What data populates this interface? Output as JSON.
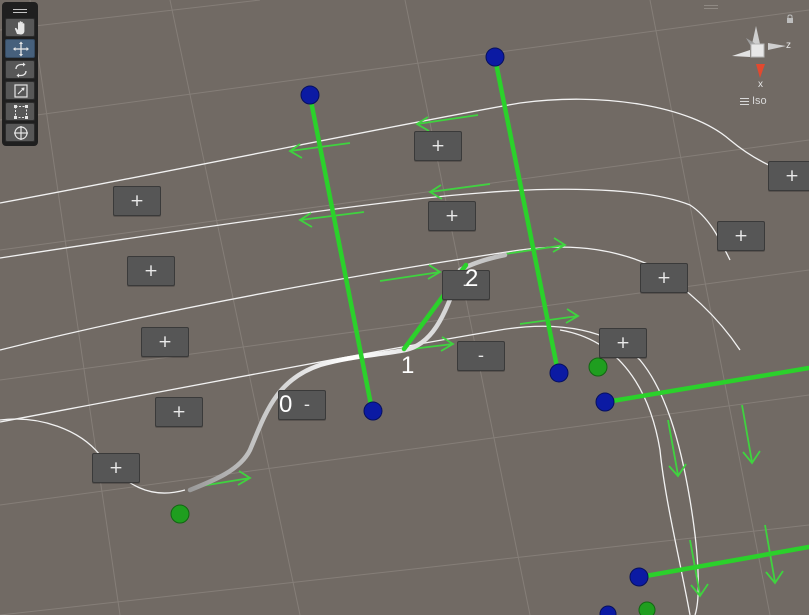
{
  "toolbar": {
    "tools": [
      {
        "name": "hand-tool",
        "icon": "hand-icon",
        "active": false
      },
      {
        "name": "move-tool",
        "icon": "move-icon",
        "active": true
      },
      {
        "name": "rotate-tool",
        "icon": "rotate-icon",
        "active": false
      },
      {
        "name": "scale-tool",
        "icon": "scale-icon",
        "active": false
      },
      {
        "name": "rect-tool",
        "icon": "rect-transform-icon",
        "active": false
      },
      {
        "name": "transform-tool",
        "icon": "transform-icon",
        "active": false
      }
    ]
  },
  "gizmo": {
    "axis_z": "z",
    "axis_x": "x",
    "projection": "Iso",
    "colors": {
      "x": "#e2492f",
      "y": "#9ccf3a",
      "z": "#3a7be0"
    }
  },
  "scene": {
    "colors": {
      "background": "#716a64",
      "grid": "#857e78",
      "road_edge": "#f2f2f2",
      "lane_arrow": "#3fd33f",
      "connector": "#2bd12b",
      "blue_node": "#0b1aa3",
      "green_node": "#1f9e1f"
    },
    "add_label": "+",
    "remove_label": "-",
    "node_labels": [
      "0",
      "1",
      "2"
    ]
  }
}
